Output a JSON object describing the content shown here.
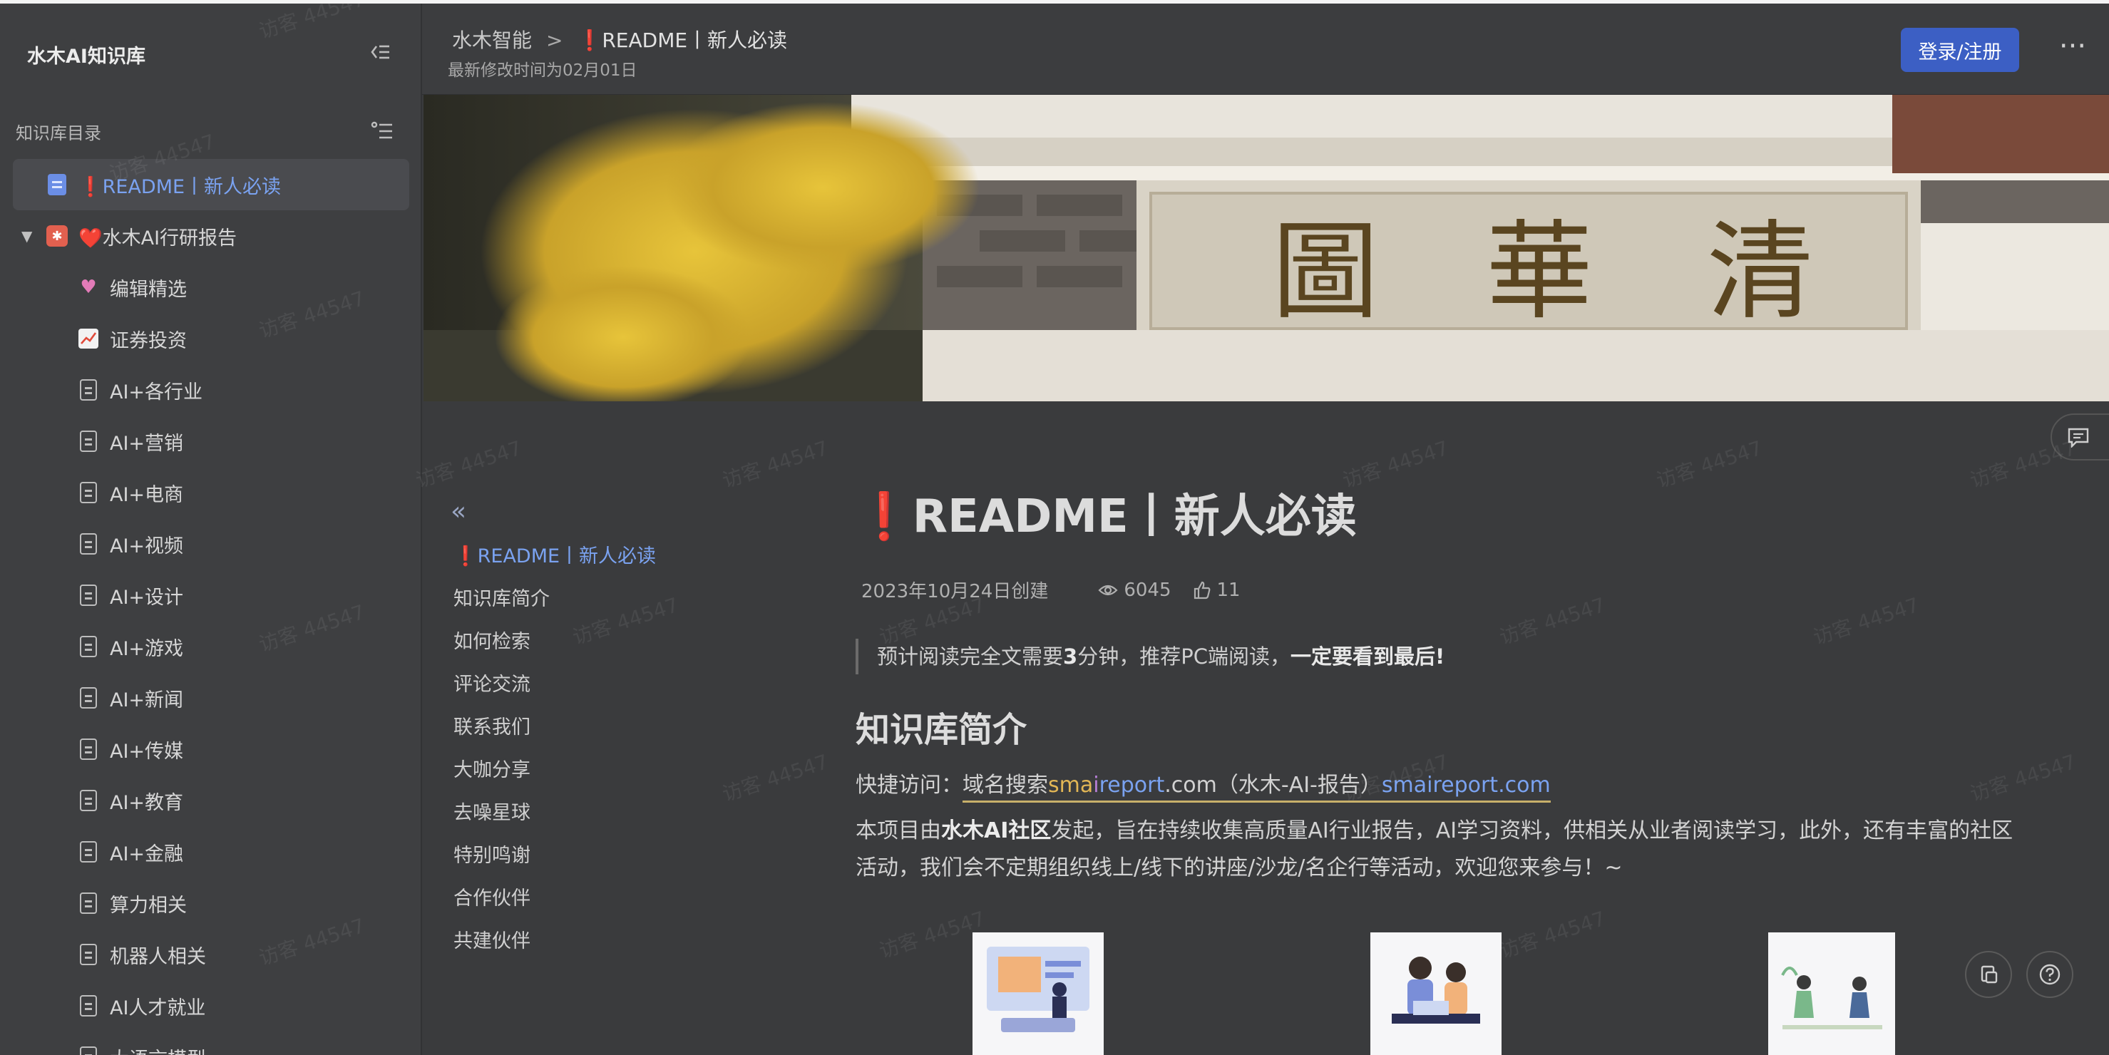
{
  "sidebar": {
    "title": "水木AI知识库",
    "section_label": "知识库目录",
    "items": [
      {
        "label": "❗README丨新人必读",
        "icon": "doc-blue-icon",
        "active": true
      },
      {
        "label": "❤️水木AI行研报告",
        "icon": "book-icon",
        "expanded": true
      },
      {
        "label": "编辑精选",
        "icon": "sparkle-heart-icon"
      },
      {
        "label": "证券投资",
        "icon": "chart-up-icon"
      },
      {
        "label": "AI+各行业",
        "icon": "doc-icon"
      },
      {
        "label": "AI+营销",
        "icon": "doc-icon"
      },
      {
        "label": "AI+电商",
        "icon": "doc-icon"
      },
      {
        "label": "AI+视频",
        "icon": "doc-icon"
      },
      {
        "label": "AI+设计",
        "icon": "doc-icon"
      },
      {
        "label": "AI+游戏",
        "icon": "doc-icon"
      },
      {
        "label": "AI+新闻",
        "icon": "doc-icon"
      },
      {
        "label": "AI+传媒",
        "icon": "doc-icon"
      },
      {
        "label": "AI+教育",
        "icon": "doc-icon"
      },
      {
        "label": "AI+金融",
        "icon": "doc-icon"
      },
      {
        "label": "算力相关",
        "icon": "doc-icon"
      },
      {
        "label": "机器人相关",
        "icon": "doc-icon"
      },
      {
        "label": "AI人才就业",
        "icon": "doc-icon"
      },
      {
        "label": "大语言模型",
        "icon": "doc-icon"
      }
    ]
  },
  "header": {
    "breadcrumb_root": "水木智能",
    "breadcrumb_separator": ">",
    "breadcrumb_current": "❗README丨新人必读",
    "modified": "最新修改时间为02月01日",
    "login_label": "登录/注册",
    "more_label": "···"
  },
  "toc": {
    "collapse_label": "«",
    "items": [
      {
        "label": "❗README丨新人必读",
        "active": true
      },
      {
        "label": "知识库简介"
      },
      {
        "label": "如何检索"
      },
      {
        "label": "评论交流"
      },
      {
        "label": "联系我们"
      },
      {
        "label": "大咖分享"
      },
      {
        "label": "去噪星球"
      },
      {
        "label": "特别鸣谢"
      },
      {
        "label": "合作伙伴"
      },
      {
        "label": "共建伙伴"
      }
    ]
  },
  "article": {
    "title": "❗README丨新人必读",
    "created": "2023年10月24日创建",
    "views": "6045",
    "likes": "11",
    "quote_pre": "预计阅读完全文需要",
    "quote_num": "3",
    "quote_mid": "分钟，推荐PC端阅读，",
    "quote_bold": "一定要看到最后",
    "quote_end": "!",
    "h2": "知识库简介",
    "quick_label": "快捷访问：",
    "quick_pre": "域名搜索",
    "quick_sm": "sma",
    "quick_i": "i",
    "quick_report": "report",
    "quick_mid": ".com（水木-AI-报告）",
    "quick_link": "smaireport.com",
    "para_pre": "本项目由",
    "para_bold": "水木AI社区",
    "para_rest": "发起，旨在持续收集高质量AI行业报告，AI学习资料，供相关从业者阅读学习，此外，还有丰富的社区活动，我们会不定期组织线上/线下的讲座/沙龙/名企行等活动，欢迎您来参与！~"
  },
  "watermark": "访客 44547",
  "colors": {
    "accent": "#3c5fc4",
    "link": "#7aa2f0",
    "background": "#3a3b3d",
    "sidebar": "#3e3f41"
  }
}
